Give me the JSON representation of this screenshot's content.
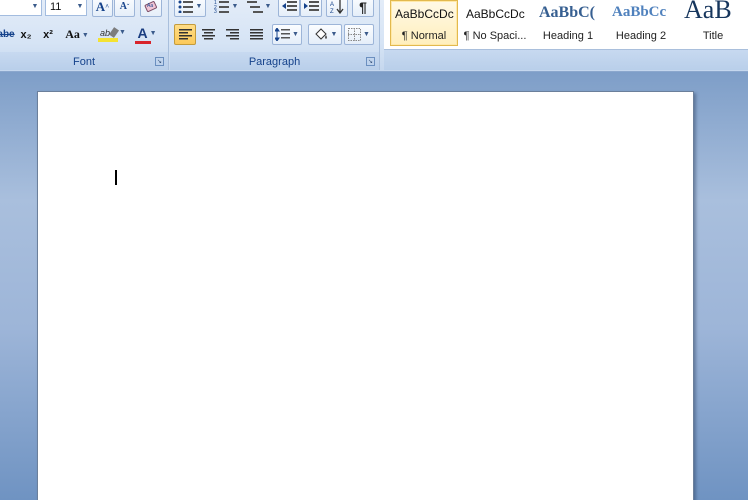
{
  "font_group": {
    "label": "Font",
    "font_size": "11",
    "grow_font_label": "A",
    "shrink_font_label": "A",
    "strikethrough_label": "abe",
    "subscript_label": "x₂",
    "superscript_label": "x²",
    "change_case_label": "Aa",
    "highlight_label": "ab",
    "font_color_label": "A",
    "highlight_color": "#f4e232",
    "font_color": "#d8242b"
  },
  "paragraph_group": {
    "label": "Paragraph",
    "active_alignment": "align-left"
  },
  "styles_group": {
    "styles": [
      {
        "sample": "AaBbCcDc",
        "name": "¶ Normal",
        "selected": true
      },
      {
        "sample": "AaBbCcDc",
        "name": "¶ No Spaci...",
        "selected": false
      },
      {
        "sample": "AaBbC(",
        "name": "Heading 1",
        "selected": false
      },
      {
        "sample": "AaBbCc",
        "name": "Heading 2",
        "selected": false
      },
      {
        "sample": "AaB",
        "name": "Title",
        "selected": false
      }
    ]
  },
  "colors": {
    "ribbon_text": "#15428b",
    "heading1": "#365f91",
    "heading2": "#4f81bd",
    "title": "#17365d"
  }
}
